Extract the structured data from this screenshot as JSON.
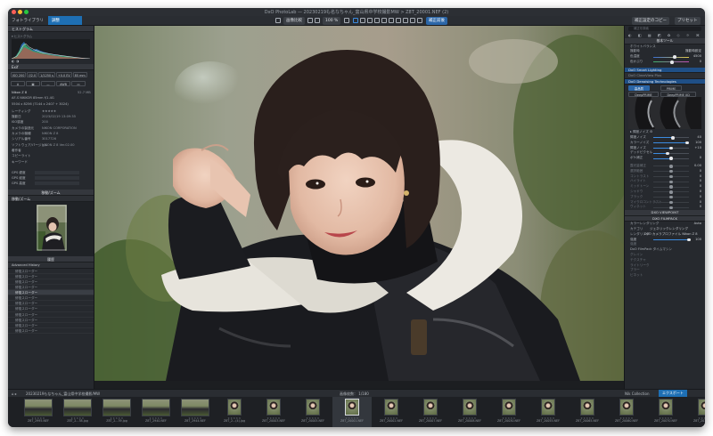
{
  "window": {
    "title": "DxO PhotoLab — 20230219も名なちゃん_富山県中学校撮影MW > Z8T_20001.NEF (2)"
  },
  "toolbar": {
    "tabs": [
      "フォトライブラリ",
      "調整"
    ],
    "compare_label": "画像比較",
    "zoom_label": "100 %",
    "viewmode_label": "補正前後",
    "right_buttons": [
      "補正設定のコピー",
      "プリセット"
    ]
  },
  "left_panel": {
    "histogram_title": "ヒストグラム",
    "exif_title": "Exif",
    "exif_values": [
      "ISO 200",
      "f/2.0",
      "1/1250 s",
      "+0.0 EV",
      "85 mm"
    ],
    "camera": "Nikon Z 8",
    "size_label": "52.7 MB",
    "lens": "AF-S NIKKOR 85mm f/1.4G",
    "dims": "5504 x 8256 (7144 x 2407 + 3024)",
    "meta_rows": [
      {
        "k": "レーティング",
        "v": "★★★★★"
      },
      {
        "k": "撮影日",
        "v": "2023/02/19 13:09:35"
      },
      {
        "k": "ISO感度",
        "v": "200"
      },
      {
        "k": "カメラの製造元",
        "v": "NIKON CORPORATION"
      },
      {
        "k": "カメラの機種",
        "v": "NIKON Z 8"
      },
      {
        "k": "シリアル番号",
        "v": "3017726"
      },
      {
        "k": "ソフトウェア/バージョン",
        "v": "NIKON Z 8 Ver.02.00"
      },
      {
        "k": "著作者",
        "v": ""
      },
      {
        "k": "コピーライト",
        "v": ""
      },
      {
        "k": "キーワード",
        "v": ""
      }
    ],
    "gps_rows": [
      "GPS 緯度",
      "GPS 経度",
      "GPS 高度"
    ],
    "navigator_title": "移動/ズーム",
    "history_title": "履歴",
    "history_dropdown": "Advanced History",
    "history_items": [
      "修復スローダー",
      "修復スローダー",
      "修復スローダー",
      "修復スローダー",
      "修復スローダー",
      "修復スローダー",
      "修復スローダー",
      "修復スローダー",
      "修復スローダー",
      "修復スローダー",
      "修復スローダー",
      "修復スローダー"
    ],
    "history_selected": 4
  },
  "right_panel": {
    "search_placeholder": "補正を検索",
    "basic_title": "基本ツール",
    "wb_rows": [
      {
        "label": "ホワイトバランス",
        "value": ""
      },
      {
        "label": "撮影時",
        "value": "撮影時設定"
      },
      {
        "label": "色温度",
        "value": "4500"
      },
      {
        "label": "色かぶり",
        "value": "0"
      }
    ],
    "smart_lighting": "DxO Smart Lighting",
    "clearview": "DxO ClearView Plus",
    "denoise": "DxO Denoising Technologies",
    "denoise_modes": [
      "高品質",
      "PRIME",
      "DeepPRIME",
      "DeepPRIME XD"
    ],
    "sliders": [
      {
        "label": "輝度ノイズ",
        "value": "40",
        "pos": 0.55
      },
      {
        "label": "カラーノイズ",
        "value": "100",
        "pos": 0.95
      },
      {
        "label": "輝度ノイズ",
        "value": "+10",
        "pos": 0.5
      },
      {
        "label": "デッドピクセル",
        "value": "",
        "pos": 0.4
      },
      {
        "label": "ボケ補正",
        "value": "0",
        "pos": 0.5
      }
    ],
    "tone_rows": [
      {
        "label": "露光量補正",
        "value": "0.00"
      },
      {
        "label": "選択範囲",
        "value": "0"
      },
      {
        "label": "コントラスト",
        "value": "0"
      },
      {
        "label": "ハイライト",
        "value": "0"
      },
      {
        "label": "ミッドトーン",
        "value": "0"
      },
      {
        "label": "シャドウ",
        "value": "0"
      },
      {
        "label": "ブラック",
        "value": "0"
      },
      {
        "label": "マイクロコントラスト",
        "value": "0"
      },
      {
        "label": "ヴィネット",
        "value": "0"
      }
    ],
    "viewpoint_title": "DXO VIEWPOINT",
    "filmpack_title": "DXO FILMPACK",
    "filmpack_rows": [
      {
        "label": "カラーレンダリング",
        "value": "Auto"
      },
      {
        "label": "カテゴリ",
        "value": "ジェネリックレンダリング"
      },
      {
        "label": "レンダリング",
        "value": "DxO カメラプロファイル Nikon Z 8"
      },
      {
        "label": "強度",
        "value": "100"
      }
    ],
    "extra_rows": [
      "強度",
      "DxO FilmPack タイムマシン",
      "グレイン",
      "テクスチャ",
      "ライトリーク",
      "ブラー",
      "ビネット"
    ]
  },
  "filmstrip": {
    "path": "20230219もなちゃん_富山県中学校撮影/MW",
    "counter": "画像枚数：  1/180",
    "nik_label": "Nik Collection",
    "export_label": "エクスポート",
    "thumbs": [
      {
        "name": "Z8T_2995.NEF",
        "orient": "land"
      },
      {
        "name": "Z8T_2...38.jpg",
        "orient": "land"
      },
      {
        "name": "Z8T_2...39.jpg",
        "orient": "land"
      },
      {
        "name": "Z8T_2940.NEF",
        "orient": "land"
      },
      {
        "name": "Z8T_2944.NEF",
        "orient": "land"
      },
      {
        "name": "Z8T_2...(4).jpg",
        "orient": "port"
      },
      {
        "name": "Z8T_20003.NEF",
        "orient": "port"
      },
      {
        "name": "Z8T_20005.NEF",
        "orient": "port"
      },
      {
        "name": "Z8T_20001.NEF",
        "orient": "port"
      },
      {
        "name": "Z8T_20002.NEF",
        "orient": "port"
      },
      {
        "name": "Z8T_20007.NEF",
        "orient": "port"
      },
      {
        "name": "Z8T_20008.NEF",
        "orient": "port"
      },
      {
        "name": "Z8T_20030.NEF",
        "orient": "port"
      },
      {
        "name": "Z8T_20055.NEF",
        "orient": "port"
      },
      {
        "name": "Z8T_20065.NEF",
        "orient": "port"
      },
      {
        "name": "Z8T_20060.NEF",
        "orient": "port"
      },
      {
        "name": "Z8T_20070.NEF",
        "orient": "port"
      },
      {
        "name": "Z8T_20105.NEF",
        "orient": "port"
      }
    ],
    "selected": 8
  },
  "colors": {
    "accent": "#1e6fb4",
    "panel": "#26292e",
    "header": "#34373d"
  }
}
